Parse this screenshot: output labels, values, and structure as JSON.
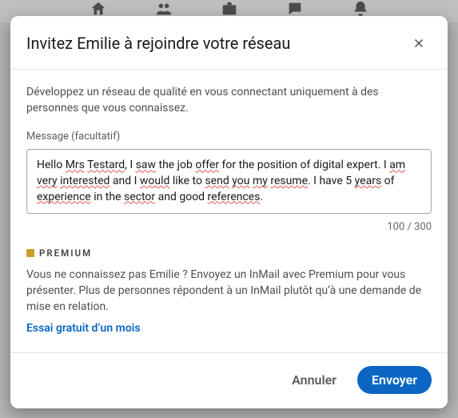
{
  "modal": {
    "title": "Invitez Emilie à rejoindre votre réseau",
    "intro": "Développez un réseau de qualité en vous connectant uniquement à des personnes que vous connaissez.",
    "field_label": "Message (facultatif)",
    "message_parts": [
      {
        "t": "Hello "
      },
      {
        "t": "Mrs",
        "err": true
      },
      {
        "t": " "
      },
      {
        "t": "Testard",
        "err": true
      },
      {
        "t": ", I "
      },
      {
        "t": "saw",
        "err": true
      },
      {
        "t": " the job "
      },
      {
        "t": "offer",
        "err": true
      },
      {
        "t": " for the position of digital expert. I "
      },
      {
        "t": "am",
        "err": true
      },
      {
        "t": " "
      },
      {
        "t": "very",
        "err": true
      },
      {
        "t": " "
      },
      {
        "t": "interested",
        "err": true
      },
      {
        "t": " and I "
      },
      {
        "t": "would",
        "err": true
      },
      {
        "t": " like to "
      },
      {
        "t": "send",
        "err": true
      },
      {
        "t": " "
      },
      {
        "t": "you",
        "err": true
      },
      {
        "t": " "
      },
      {
        "t": "my",
        "err": true
      },
      {
        "t": " "
      },
      {
        "t": "resume",
        "err": true
      },
      {
        "t": ". I have 5 "
      },
      {
        "t": "years",
        "err": true
      },
      {
        "t": " of "
      },
      {
        "t": "experience",
        "err": true
      },
      {
        "t": " in the "
      },
      {
        "t": "sector",
        "err": true
      },
      {
        "t": " and good "
      },
      {
        "t": "references",
        "err": true
      },
      {
        "t": "."
      }
    ],
    "message_plain": "Hello Mrs Testard, I saw the job offer for the position of digital expert. I am very interested and I would like to send you my resume. I have 5 years of experience in the sector and good references.",
    "counter": "100 / 300",
    "premium_label": "PREMIUM",
    "premium_text": "Vous ne connaissez pas Emilie ? Envoyez un InMail avec Premium pour vous présenter. Plus de personnes répondent à un InMail plutôt qu’à une demande de mise en relation.",
    "premium_link": "Essai gratuit d’un mois",
    "cancel": "Annuler",
    "submit": "Envoyer"
  }
}
